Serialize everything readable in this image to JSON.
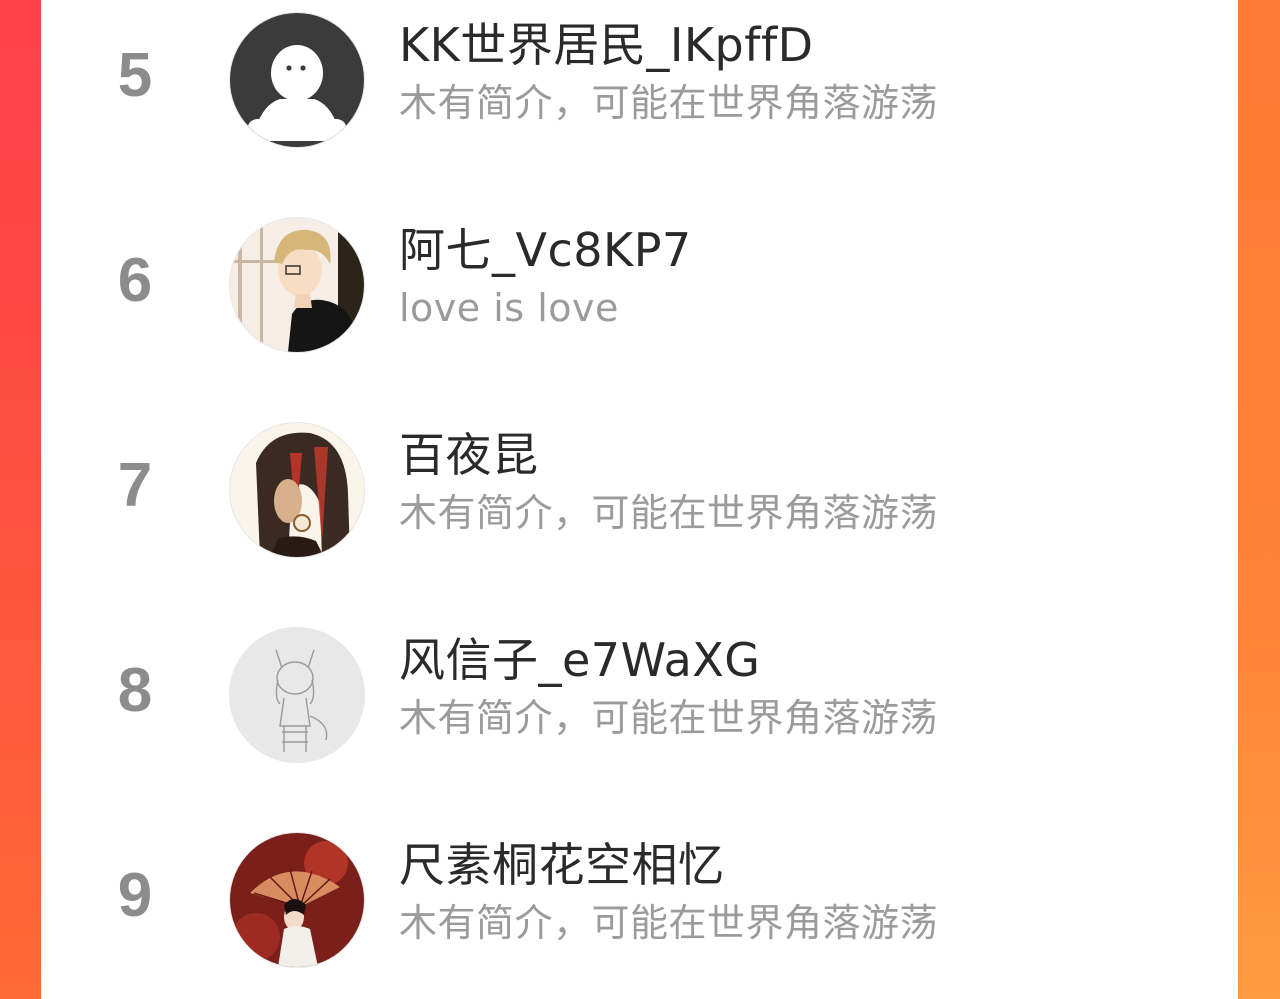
{
  "leaderboard": {
    "rows": [
      {
        "rank": "5",
        "name": "KK世界居民_IKpffD",
        "bio": "木有简介，可能在世界角落游荡",
        "avatar": "default-ghost-avatar"
      },
      {
        "rank": "6",
        "name": "阿七_Vc8KP7",
        "bio": "love is love",
        "avatar": "anime-boy-avatar"
      },
      {
        "rank": "7",
        "name": "百夜昆",
        "bio": "木有简介，可能在世界角落游荡",
        "avatar": "anime-profile-avatar"
      },
      {
        "rank": "8",
        "name": "风信子_e7WaXG",
        "bio": "木有简介，可能在世界角落游荡",
        "avatar": "sketch-catgirl-avatar"
      },
      {
        "rank": "9",
        "name": "尺素桐花空相忆",
        "bio": "木有简介，可能在世界角落游荡",
        "avatar": "red-fan-artwork-avatar"
      }
    ]
  },
  "colors": {
    "rank_gray": "#8c8c8c",
    "name_text": "#2a2a2a",
    "bio_text": "#9b9b9b",
    "accent_left": "#ff4a4a",
    "accent_right": "#ff8a3a"
  }
}
